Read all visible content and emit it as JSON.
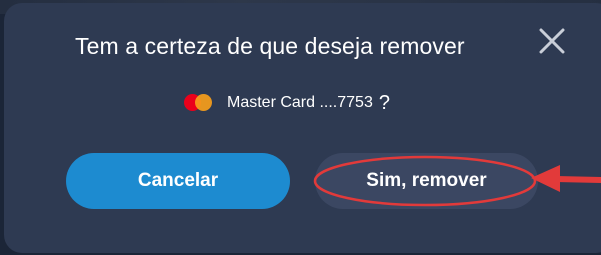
{
  "dialog": {
    "title": "Tem a certeza de que deseja remover",
    "close_icon": "close-icon",
    "card": {
      "brand_icon": "mastercard-icon",
      "label": "Master Card ....7753",
      "question_mark": "?"
    },
    "buttons": {
      "cancel_label": "Cancelar",
      "confirm_label": "Sim, remover"
    }
  },
  "colors": {
    "dialog_bg": "#2e3a52",
    "cancel_bg": "#1d8bd0",
    "confirm_bg": "#3b4762",
    "annotation": "#e23a3a"
  }
}
